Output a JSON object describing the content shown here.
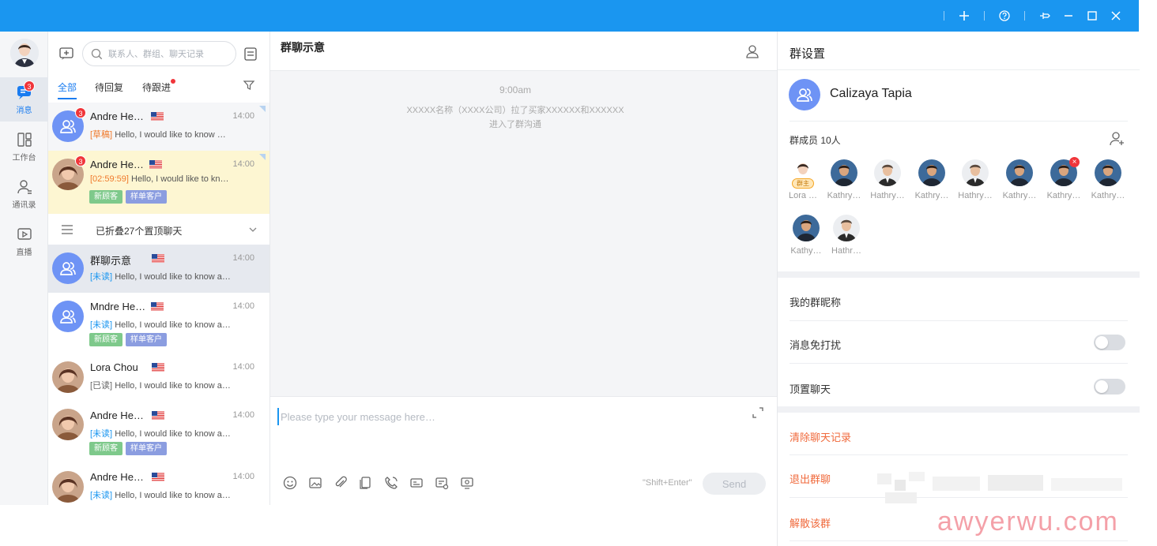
{
  "nav": {
    "items": [
      {
        "label": "消息",
        "badge": "3"
      },
      {
        "label": "工作台"
      },
      {
        "label": "通讯录"
      },
      {
        "label": "直播"
      }
    ]
  },
  "list": {
    "search_placeholder": "联系人、群组、聊天记录",
    "tabs": [
      "全部",
      "待回复",
      "待跟进"
    ],
    "fold_text": "已折叠27个置顶聊天",
    "conversations": [
      {
        "name": "Andre He…",
        "time": "14:00",
        "badge": "3",
        "prefix": "[草稿]",
        "message": "Hello, I would like to know …"
      },
      {
        "name": "Andre He…",
        "time": "14:00",
        "badge": "3",
        "prefix": "[02:59:59]",
        "message": "Hello, I would like to kn…",
        "tags": [
          "新顾客",
          "样单客户"
        ]
      },
      {
        "name": "群聊示意",
        "time": "14:00",
        "prefix": "[未读]",
        "message": "Hello, I would like to know a…"
      },
      {
        "name": "Mndre He…",
        "time": "14:00",
        "prefix": "[未读]",
        "message": "Hello, I would like to know a…",
        "tags": [
          "新顾客",
          "样单客户"
        ]
      },
      {
        "name": "Lora Chou",
        "time": "14:00",
        "prefix": "[已读]",
        "message": "Hello, I would like to know a…"
      },
      {
        "name": "Andre He…",
        "time": "14:00",
        "prefix": "[未读]",
        "message": "Hello, I would like to know a…",
        "tags": [
          "新顾客",
          "样单客户"
        ]
      },
      {
        "name": "Andre He…",
        "time": "14:00",
        "prefix": "[未读]",
        "message": "Hello, I would like to know a…"
      }
    ]
  },
  "chat": {
    "title": "群聊示意",
    "time": "9:00am",
    "system_line1": "XXXXX名称（XXXX公司）拉了买家XXXXXX和XXXXXX",
    "system_line2": "进入了群沟通",
    "input_placeholder": "Please type your message here…",
    "shortcut": "\"Shift+Enter\"",
    "send_label": "Send"
  },
  "settings": {
    "title": "群设置",
    "group_name": "Calizaya Tapia",
    "members_label": "群成员 10人",
    "owner_tag": "群主",
    "members": [
      "Lora …",
      "Kathry…",
      "Hathry…",
      "Kathry…",
      "Hathry…",
      "Kathry…",
      "Kathry…",
      "Kathry…",
      "Kathy…",
      "Hathr…"
    ],
    "nickname_label": "我的群昵称",
    "mute_label": "消息免打扰",
    "pin_label": "顶置聊天",
    "clear_label": "清除聊天记录",
    "exit_label": "退出群聊",
    "dissolve_label": "解散该群"
  },
  "watermark": "awyerwu.com",
  "colors": {
    "titlebar": "#1a96f0",
    "accent": "#1a7cf0",
    "badge": "#f0353a",
    "danger": "#f06a3c",
    "group_avatar": "#6e93f5"
  }
}
